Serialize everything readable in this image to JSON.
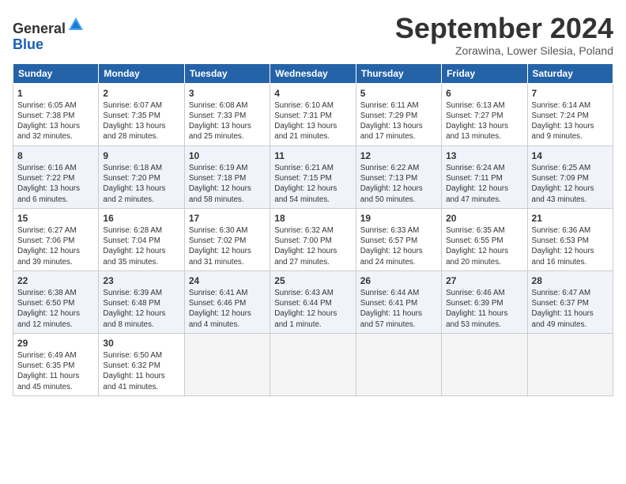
{
  "header": {
    "logo_general": "General",
    "logo_blue": "Blue",
    "title": "September 2024",
    "location": "Zorawina, Lower Silesia, Poland"
  },
  "calendar": {
    "days_of_week": [
      "Sunday",
      "Monday",
      "Tuesday",
      "Wednesday",
      "Thursday",
      "Friday",
      "Saturday"
    ],
    "weeks": [
      [
        {
          "day": "1",
          "info": "Sunrise: 6:05 AM\nSunset: 7:38 PM\nDaylight: 13 hours\nand 32 minutes."
        },
        {
          "day": "2",
          "info": "Sunrise: 6:07 AM\nSunset: 7:35 PM\nDaylight: 13 hours\nand 28 minutes."
        },
        {
          "day": "3",
          "info": "Sunrise: 6:08 AM\nSunset: 7:33 PM\nDaylight: 13 hours\nand 25 minutes."
        },
        {
          "day": "4",
          "info": "Sunrise: 6:10 AM\nSunset: 7:31 PM\nDaylight: 13 hours\nand 21 minutes."
        },
        {
          "day": "5",
          "info": "Sunrise: 6:11 AM\nSunset: 7:29 PM\nDaylight: 13 hours\nand 17 minutes."
        },
        {
          "day": "6",
          "info": "Sunrise: 6:13 AM\nSunset: 7:27 PM\nDaylight: 13 hours\nand 13 minutes."
        },
        {
          "day": "7",
          "info": "Sunrise: 6:14 AM\nSunset: 7:24 PM\nDaylight: 13 hours\nand 9 minutes."
        }
      ],
      [
        {
          "day": "8",
          "info": "Sunrise: 6:16 AM\nSunset: 7:22 PM\nDaylight: 13 hours\nand 6 minutes."
        },
        {
          "day": "9",
          "info": "Sunrise: 6:18 AM\nSunset: 7:20 PM\nDaylight: 13 hours\nand 2 minutes."
        },
        {
          "day": "10",
          "info": "Sunrise: 6:19 AM\nSunset: 7:18 PM\nDaylight: 12 hours\nand 58 minutes."
        },
        {
          "day": "11",
          "info": "Sunrise: 6:21 AM\nSunset: 7:15 PM\nDaylight: 12 hours\nand 54 minutes."
        },
        {
          "day": "12",
          "info": "Sunrise: 6:22 AM\nSunset: 7:13 PM\nDaylight: 12 hours\nand 50 minutes."
        },
        {
          "day": "13",
          "info": "Sunrise: 6:24 AM\nSunset: 7:11 PM\nDaylight: 12 hours\nand 47 minutes."
        },
        {
          "day": "14",
          "info": "Sunrise: 6:25 AM\nSunset: 7:09 PM\nDaylight: 12 hours\nand 43 minutes."
        }
      ],
      [
        {
          "day": "15",
          "info": "Sunrise: 6:27 AM\nSunset: 7:06 PM\nDaylight: 12 hours\nand 39 minutes."
        },
        {
          "day": "16",
          "info": "Sunrise: 6:28 AM\nSunset: 7:04 PM\nDaylight: 12 hours\nand 35 minutes."
        },
        {
          "day": "17",
          "info": "Sunrise: 6:30 AM\nSunset: 7:02 PM\nDaylight: 12 hours\nand 31 minutes."
        },
        {
          "day": "18",
          "info": "Sunrise: 6:32 AM\nSunset: 7:00 PM\nDaylight: 12 hours\nand 27 minutes."
        },
        {
          "day": "19",
          "info": "Sunrise: 6:33 AM\nSunset: 6:57 PM\nDaylight: 12 hours\nand 24 minutes."
        },
        {
          "day": "20",
          "info": "Sunrise: 6:35 AM\nSunset: 6:55 PM\nDaylight: 12 hours\nand 20 minutes."
        },
        {
          "day": "21",
          "info": "Sunrise: 6:36 AM\nSunset: 6:53 PM\nDaylight: 12 hours\nand 16 minutes."
        }
      ],
      [
        {
          "day": "22",
          "info": "Sunrise: 6:38 AM\nSunset: 6:50 PM\nDaylight: 12 hours\nand 12 minutes."
        },
        {
          "day": "23",
          "info": "Sunrise: 6:39 AM\nSunset: 6:48 PM\nDaylight: 12 hours\nand 8 minutes."
        },
        {
          "day": "24",
          "info": "Sunrise: 6:41 AM\nSunset: 6:46 PM\nDaylight: 12 hours\nand 4 minutes."
        },
        {
          "day": "25",
          "info": "Sunrise: 6:43 AM\nSunset: 6:44 PM\nDaylight: 12 hours\nand 1 minute."
        },
        {
          "day": "26",
          "info": "Sunrise: 6:44 AM\nSunset: 6:41 PM\nDaylight: 11 hours\nand 57 minutes."
        },
        {
          "day": "27",
          "info": "Sunrise: 6:46 AM\nSunset: 6:39 PM\nDaylight: 11 hours\nand 53 minutes."
        },
        {
          "day": "28",
          "info": "Sunrise: 6:47 AM\nSunset: 6:37 PM\nDaylight: 11 hours\nand 49 minutes."
        }
      ],
      [
        {
          "day": "29",
          "info": "Sunrise: 6:49 AM\nSunset: 6:35 PM\nDaylight: 11 hours\nand 45 minutes."
        },
        {
          "day": "30",
          "info": "Sunrise: 6:50 AM\nSunset: 6:32 PM\nDaylight: 11 hours\nand 41 minutes."
        },
        {
          "day": "",
          "info": ""
        },
        {
          "day": "",
          "info": ""
        },
        {
          "day": "",
          "info": ""
        },
        {
          "day": "",
          "info": ""
        },
        {
          "day": "",
          "info": ""
        }
      ]
    ]
  }
}
